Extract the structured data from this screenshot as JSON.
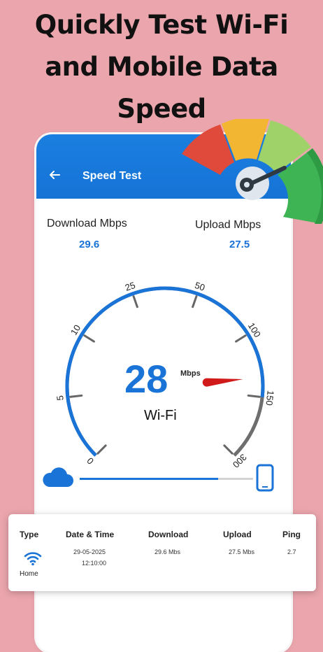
{
  "promo": {
    "headline_lines": [
      "Quickly Test Wi-Fi",
      "and Mobile Data",
      "Speed"
    ]
  },
  "appbar": {
    "title": "Speed Test",
    "back_icon": "arrow-left-icon"
  },
  "stats": {
    "download_label": "Download Mbps",
    "download_value": "29.6",
    "upload_label": "Upload Mbps",
    "upload_value": "27.5"
  },
  "gauge": {
    "tick_labels": [
      "0",
      "5",
      "10",
      "25",
      "50",
      "100",
      "150",
      "300"
    ],
    "current_speed": "28",
    "unit": "Mbps",
    "connection": "Wi-Fi",
    "accent": "#1a73d6",
    "needle_color": "#d11a1a"
  },
  "progress": {
    "fraction": 0.8,
    "left_icon": "cloud-icon",
    "right_icon": "smartphone-icon"
  },
  "history": {
    "headers": [
      "Type",
      "Date & Time",
      "Download",
      "Upload",
      "Ping"
    ],
    "row": {
      "type_icon": "wifi-icon",
      "type": "Home",
      "date": "29-05-2025",
      "time": "12:10:00",
      "download": "29.6 Mbs",
      "upload": "27.5 Mbs",
      "ping": "2.7"
    }
  }
}
